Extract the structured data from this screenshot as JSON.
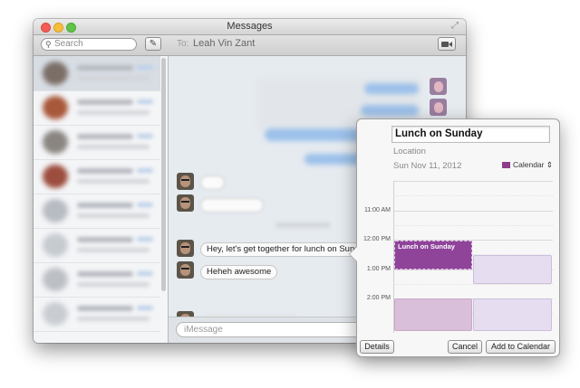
{
  "window": {
    "title": "Messages"
  },
  "toolbar": {
    "search_placeholder": "Search",
    "to_label": "To:",
    "recipient": "Leah Vin Zant"
  },
  "messages": [
    {
      "text": "Hey, let's get together for lunch on Sunday!"
    },
    {
      "text": "Heheh awesome"
    }
  ],
  "input": {
    "placeholder": "iMessage"
  },
  "event_popover": {
    "title": "Lunch on Sunday",
    "location_placeholder": "Location",
    "date": "Sun Nov 11, 2012",
    "calendar_name": "Calendar",
    "calendar_color": "#8e3f8c",
    "hours": [
      "11:00 AM",
      "12:00 PM",
      "1:00 PM",
      "2:00 PM"
    ],
    "event_label": "Lunch on Sunday",
    "buttons": {
      "details": "Details",
      "cancel": "Cancel",
      "add": "Add to Calendar"
    }
  }
}
